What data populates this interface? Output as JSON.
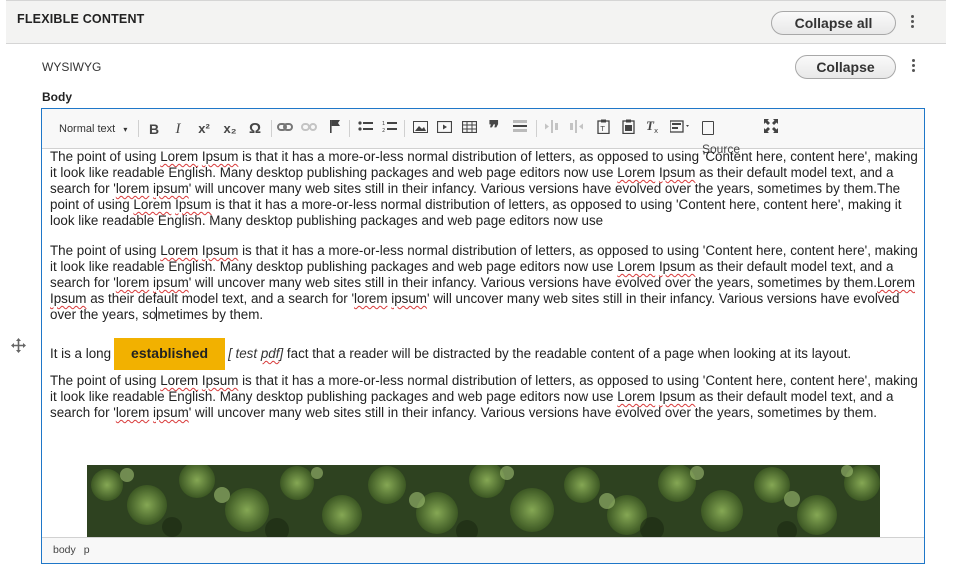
{
  "section": {
    "title": "FLEXIBLE CONTENT",
    "collapse_all_label": "Collapse all"
  },
  "paragraph": {
    "type_label": "WYSIWYG",
    "collapse_label": "Collapse",
    "field_label": "Body"
  },
  "toolbar": {
    "format_value": "Normal text",
    "bold": "B",
    "italic": "I",
    "superscript": "x²",
    "subscript": "x₂",
    "special_char": "Ω",
    "blockquote": "❞",
    "source_label": "Source"
  },
  "content": {
    "para1_parts": [
      "The point of using ",
      "Lorem",
      " ",
      "Ipsum",
      " is that it has a more-or-less normal distribution of letters, as opposed to using 'Content here, content here', making it look like readable English. Many desktop publishing packages and web page editors now use ",
      "Lorem",
      " ",
      "Ipsum",
      " as their default model text, and a search for '",
      "lorem",
      " ",
      "ipsum",
      "' will uncover many web sites still in their infancy. Various versions have evolved over the years, sometimes by them.The point of using ",
      "Lorem",
      " ",
      "Ipsum",
      " is that it has a more-or-less normal distribution of letters, as opposed to using 'Content here, content here', making it look like readable English. Many desktop publishing packages and web page editors now use"
    ],
    "para2_parts": [
      "The point of using ",
      "Lorem",
      " ",
      "Ipsum",
      " is that it has a more-or-less normal distribution of letters, as opposed to using 'Content here, content here', making it look like readable English. Many desktop publishing packages and web page editors now use ",
      "Lorem",
      " ",
      "Ipsum",
      " as their default model text, and a search for '",
      "lorem",
      " ",
      "ipsum",
      "' will uncover many web sites still in their infancy. Various versions have evolved over the years, sometimes by them.",
      "Lorem",
      " ",
      "Ipsum",
      " as their default model text, and a search for '",
      "lorem",
      " ",
      "ipsum",
      "' will uncover many web sites still in their infancy. Various versions have evolved over the years, so",
      "metimes by them."
    ],
    "para3_before": "It is a long",
    "para3_badge": "established",
    "para3_cite_open": "[ test ",
    "para3_cite_word": "pdf",
    "para3_cite_close": "]",
    "para3_after": " fact that a reader will be distracted by the readable content of a page when looking at its layout.",
    "para4_parts": [
      "The point of using ",
      "Lorem",
      " ",
      "Ipsum",
      " is that it has a more-or-less normal distribution of letters, as opposed to using 'Content here, content here', making it look like readable English. Many desktop publishing packages and web page editors now use ",
      "Lorem",
      " ",
      "Ipsum",
      " as their default model text, and a search for '",
      "lorem",
      " ",
      "ipsum",
      "' will uncover many web sites still in their infancy. Various versions have evolved over the years, sometimes by them."
    ]
  },
  "statusbar": {
    "path": [
      "body",
      "p"
    ]
  },
  "colors": {
    "editor_border": "#1f77c8",
    "badge": "#f2b100",
    "header_bg": "#f3f3f2"
  }
}
